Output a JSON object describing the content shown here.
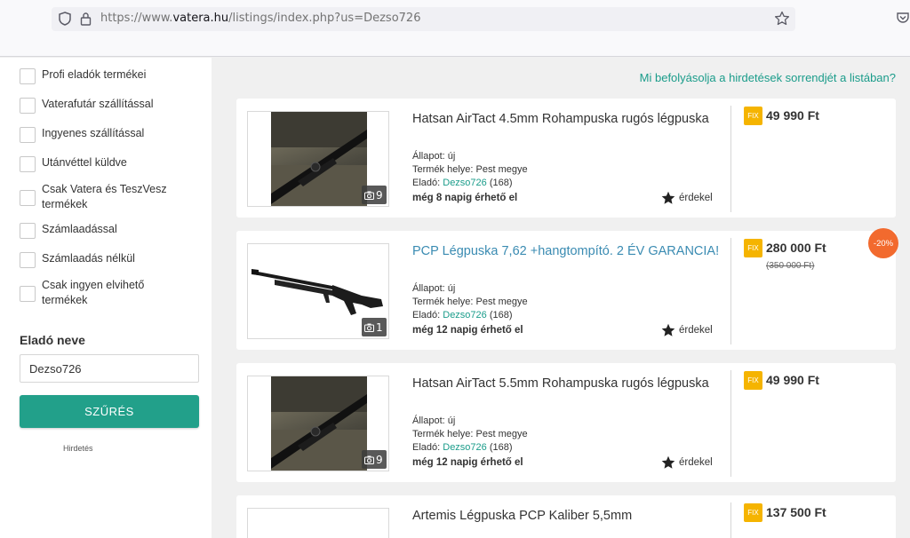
{
  "browser": {
    "url_prefix": "https://www.",
    "url_host": "vatera.hu",
    "url_path": "/listings/index.php?us=Dezso726"
  },
  "sidebar": {
    "filters": [
      {
        "label": "Profi eladók termékei"
      },
      {
        "label": "Vaterafutár szállítással"
      },
      {
        "label": "Ingyenes szállítással"
      },
      {
        "label": "Utánvéttel küldve"
      },
      {
        "label": "Csak Vatera és TeszVesz termékek"
      },
      {
        "label": "Számlaadással"
      },
      {
        "label": "Számlaadás nélkül"
      },
      {
        "label": "Csak ingyen elvihető termékek"
      }
    ],
    "seller_heading": "Eladó neve",
    "seller_value": "Dezso726",
    "filter_button": "SZŰRÉS",
    "ad_label": "Hirdetés"
  },
  "main": {
    "help_link": "Mi befolyásolja a hirdetések sorrendjét a listában?",
    "labels": {
      "condition_prefix": "Állapot: ",
      "location_prefix": "Termék helye: ",
      "seller_prefix": "Eladó: ",
      "watch": "érdekel",
      "fix": "FIX"
    },
    "listings": [
      {
        "title": "Hatsan AirTact 4.5mm Rohampuska rugós légpuska",
        "photo_count": "9",
        "condition": "új",
        "location": "Pest megye",
        "seller": "Dezso726",
        "seller_rating": "(168)",
        "expiry": "még 8 napig érhető el",
        "price": "49 990 Ft",
        "old_price": "",
        "discount": ""
      },
      {
        "title": "PCP Légpuska 7,62 +hangtompító. 2 ÉV GARANCIA!",
        "photo_count": "1",
        "condition": "új",
        "location": "Pest megye",
        "seller": "Dezso726",
        "seller_rating": "(168)",
        "expiry": "még 12 napig érhető el",
        "price": "280 000 Ft",
        "old_price": "(350 000 Ft)",
        "discount": "-20%"
      },
      {
        "title": "Hatsan AirTact 5.5mm Rohampuska rugós légpuska",
        "photo_count": "9",
        "condition": "új",
        "location": "Pest megye",
        "seller": "Dezso726",
        "seller_rating": "(168)",
        "expiry": "még 12 napig érhető el",
        "price": "49 990 Ft",
        "old_price": "",
        "discount": ""
      },
      {
        "title": "Artemis Légpuska PCP Kaliber 5,5mm",
        "price": "137 500 Ft"
      }
    ]
  },
  "colors": {
    "accent": "#22a08a",
    "link": "#1a9c8a",
    "title_link": "#3a8bb2",
    "fix": "#f5b400",
    "discount": "#f26a2e"
  }
}
